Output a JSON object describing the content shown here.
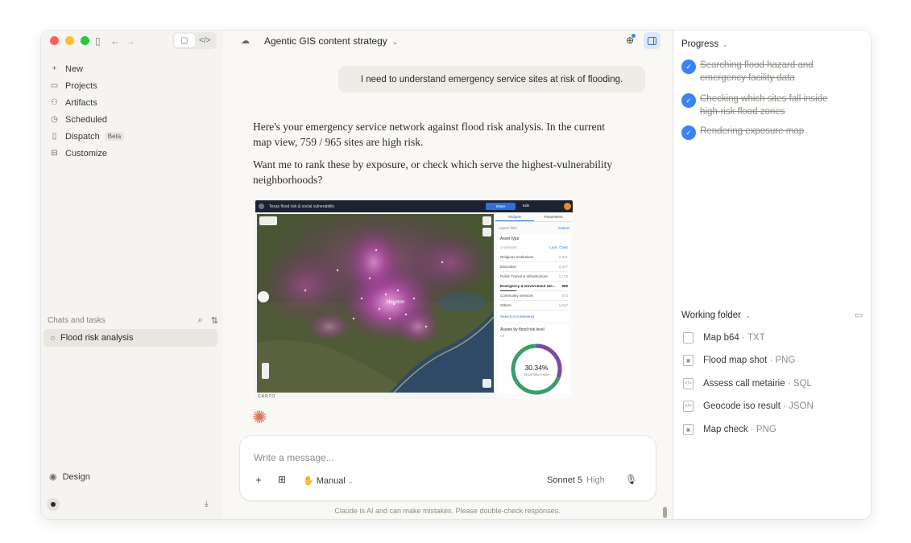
{
  "colors": {
    "accent": "#3b82f6",
    "close": "#ff5f57",
    "minimize": "#febc2e",
    "maximize": "#28c840",
    "spark": "#d9765a"
  },
  "sidebar": {
    "nav": [
      {
        "label": "New",
        "icon": "plus-icon"
      },
      {
        "label": "Projects",
        "icon": "folder-icon"
      },
      {
        "label": "Artifacts",
        "icon": "artifacts-icon"
      },
      {
        "label": "Scheduled",
        "icon": "clock-icon"
      },
      {
        "label": "Dispatch",
        "icon": "dispatch-icon",
        "badge": "Beta"
      },
      {
        "label": "Customize",
        "icon": "briefcase-icon"
      }
    ],
    "chats_heading": "Chats and tasks",
    "chat_item": "Flood risk analysis",
    "design_label": "Design"
  },
  "header": {
    "title": "Agentic GIS content strategy"
  },
  "conversation": {
    "user_message": "I need to understand emergency service sites at risk of flooding.",
    "response_p1": "Here's your emergency service network against flood risk analysis. In the current map view, 759 / 965 sites are high risk.",
    "response_p2": "Want me to rank these by exposure, or check which serve the highest-vulnerability neighborhoods?"
  },
  "map_screenshot": {
    "title": "Texas flood risk & social vulnerability",
    "share": "Share",
    "edit": "Edit",
    "carto": "CARTO",
    "tabs": [
      "Widgets",
      "Parameters"
    ],
    "sub_left": "Layers filter",
    "sub_right": "Cancel",
    "asset_type_heading": "Asset type",
    "selected": "1 selected",
    "lock": "Lock",
    "clear": "Clear",
    "asset_rows": [
      {
        "label": "Religious Institutions",
        "value": "2,921"
      },
      {
        "label": "Education",
        "value": "2,447"
      },
      {
        "label": "Public Transit & Infrastructure",
        "value": "1,179"
      },
      {
        "label": "Emergency & Government Ser...",
        "value": "965"
      },
      {
        "label": "Community Services",
        "value": "572"
      },
      {
        "label": "Others",
        "value": "1,047"
      }
    ],
    "search_link": "Search in 5 elements",
    "flood_heading": "Assets by flood risk level",
    "all_label": "All",
    "donut_pct": "30.34%",
    "donut_label": "RELATIVELY HIGH",
    "city_label": "Houston",
    "donut_fraction": 0.3034
  },
  "composer": {
    "placeholder": "Write a message...",
    "mode": "Manual",
    "model": "Sonnet 5",
    "effort": "High"
  },
  "disclaimer": "Claude is AI and can make mistakes. Please double-check responses.",
  "progress": {
    "heading": "Progress",
    "steps": [
      "Searching flood hazard and emergency facility data",
      "Checking which sites fall inside high-risk flood zones",
      "Rendering exposure map"
    ]
  },
  "working_folder": {
    "heading": "Working folder",
    "files": [
      {
        "name": "Map b64",
        "type": "TXT"
      },
      {
        "name": "Flood map shot",
        "type": "PNG"
      },
      {
        "name": "Assess call metairie",
        "type": "SQL"
      },
      {
        "name": "Geocode iso result",
        "type": "JSON"
      },
      {
        "name": "Map check",
        "type": "PNG"
      }
    ]
  }
}
